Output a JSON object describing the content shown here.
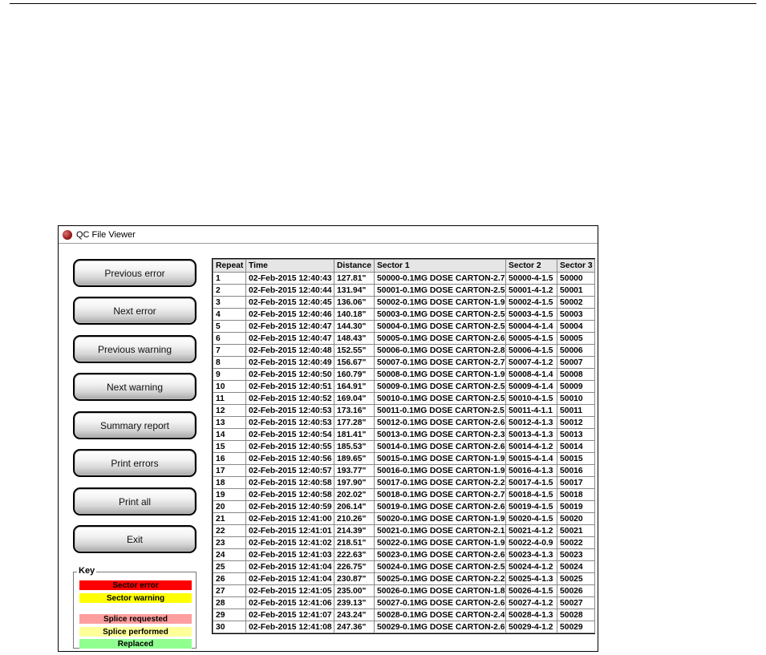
{
  "window": {
    "title": "QC File Viewer"
  },
  "buttons": [
    {
      "label": "Previous error"
    },
    {
      "label": "Next error"
    },
    {
      "label": "Previous warning"
    },
    {
      "label": "Next warning"
    },
    {
      "label": "Summary report"
    },
    {
      "label": "Print errors"
    },
    {
      "label": "Print all"
    },
    {
      "label": "Exit"
    }
  ],
  "key": {
    "title": "Key",
    "items": [
      {
        "label": "Sector error",
        "color": "#ff0000"
      },
      {
        "label": "Sector warning",
        "color": "#ffff00"
      },
      {
        "label": "Splice requested",
        "color": "#ff9e9e"
      },
      {
        "label": "Splice performed",
        "color": "#ffff99"
      },
      {
        "label": "Replaced",
        "color": "#90ff90"
      }
    ]
  },
  "table": {
    "columns": [
      "Repeat",
      "Time",
      "Distance",
      "Sector 1",
      "Sector 2",
      "Sector 3"
    ],
    "rows": [
      [
        "1",
        "02-Feb-2015 12:40:43",
        "127.81\"",
        "50000-0.1MG DOSE CARTON-2.7",
        "50000-4-1.5",
        "50000"
      ],
      [
        "2",
        "02-Feb-2015 12:40:44",
        "131.94\"",
        "50001-0.1MG DOSE CARTON-2.5",
        "50001-4-1.2",
        "50001"
      ],
      [
        "3",
        "02-Feb-2015 12:40:45",
        "136.06\"",
        "50002-0.1MG DOSE CARTON-1.9",
        "50002-4-1.5",
        "50002"
      ],
      [
        "4",
        "02-Feb-2015 12:40:46",
        "140.18\"",
        "50003-0.1MG DOSE CARTON-2.5",
        "50003-4-1.5",
        "50003"
      ],
      [
        "5",
        "02-Feb-2015 12:40:47",
        "144.30\"",
        "50004-0.1MG DOSE CARTON-2.5",
        "50004-4-1.4",
        "50004"
      ],
      [
        "6",
        "02-Feb-2015 12:40:47",
        "148.43\"",
        "50005-0.1MG DOSE CARTON-2.6",
        "50005-4-1.5",
        "50005"
      ],
      [
        "7",
        "02-Feb-2015 12:40:48",
        "152.55\"",
        "50006-0.1MG DOSE CARTON-2.8",
        "50006-4-1.5",
        "50006"
      ],
      [
        "8",
        "02-Feb-2015 12:40:49",
        "156.67\"",
        "50007-0.1MG DOSE CARTON-2.7",
        "50007-4-1.2",
        "50007"
      ],
      [
        "9",
        "02-Feb-2015 12:40:50",
        "160.79\"",
        "50008-0.1MG DOSE CARTON-1.9",
        "50008-4-1.4",
        "50008"
      ],
      [
        "10",
        "02-Feb-2015 12:40:51",
        "164.91\"",
        "50009-0.1MG DOSE CARTON-2.5",
        "50009-4-1.4",
        "50009"
      ],
      [
        "11",
        "02-Feb-2015 12:40:52",
        "169.04\"",
        "50010-0.1MG DOSE CARTON-2.5",
        "50010-4-1.5",
        "50010"
      ],
      [
        "12",
        "02-Feb-2015 12:40:53",
        "173.16\"",
        "50011-0.1MG DOSE CARTON-2.5",
        "50011-4-1.1",
        "50011"
      ],
      [
        "13",
        "02-Feb-2015 12:40:53",
        "177.28\"",
        "50012-0.1MG DOSE CARTON-2.6",
        "50012-4-1.3",
        "50012"
      ],
      [
        "14",
        "02-Feb-2015 12:40:54",
        "181.41\"",
        "50013-0.1MG DOSE CARTON-2.3",
        "50013-4-1.3",
        "50013"
      ],
      [
        "15",
        "02-Feb-2015 12:40:55",
        "185.53\"",
        "50014-0.1MG DOSE CARTON-2.6",
        "50014-4-1.2",
        "50014"
      ],
      [
        "16",
        "02-Feb-2015 12:40:56",
        "189.65\"",
        "50015-0.1MG DOSE CARTON-1.9",
        "50015-4-1.4",
        "50015"
      ],
      [
        "17",
        "02-Feb-2015 12:40:57",
        "193.77\"",
        "50016-0.1MG DOSE CARTON-1.9",
        "50016-4-1.3",
        "50016"
      ],
      [
        "18",
        "02-Feb-2015 12:40:58",
        "197.90\"",
        "50017-0.1MG DOSE CARTON-2.2",
        "50017-4-1.5",
        "50017"
      ],
      [
        "19",
        "02-Feb-2015 12:40:58",
        "202.02\"",
        "50018-0.1MG DOSE CARTON-2.7",
        "50018-4-1.5",
        "50018"
      ],
      [
        "20",
        "02-Feb-2015 12:40:59",
        "206.14\"",
        "50019-0.1MG DOSE CARTON-2.6",
        "50019-4-1.5",
        "50019"
      ],
      [
        "21",
        "02-Feb-2015 12:41:00",
        "210.26\"",
        "50020-0.1MG DOSE CARTON-1.9",
        "50020-4-1.5",
        "50020"
      ],
      [
        "22",
        "02-Feb-2015 12:41:01",
        "214.39\"",
        "50021-0.1MG DOSE CARTON-2.1",
        "50021-4-1.2",
        "50021"
      ],
      [
        "23",
        "02-Feb-2015 12:41:02",
        "218.51\"",
        "50022-0.1MG DOSE CARTON-1.9",
        "50022-4-0.9",
        "50022"
      ],
      [
        "24",
        "02-Feb-2015 12:41:03",
        "222.63\"",
        "50023-0.1MG DOSE CARTON-2.6",
        "50023-4-1.3",
        "50023"
      ],
      [
        "25",
        "02-Feb-2015 12:41:04",
        "226.75\"",
        "50024-0.1MG DOSE CARTON-2.5",
        "50024-4-1.2",
        "50024"
      ],
      [
        "26",
        "02-Feb-2015 12:41:04",
        "230.87\"",
        "50025-0.1MG DOSE CARTON-2.2",
        "50025-4-1.3",
        "50025"
      ],
      [
        "27",
        "02-Feb-2015 12:41:05",
        "235.00\"",
        "50026-0.1MG DOSE CARTON-1.8",
        "50026-4-1.5",
        "50026"
      ],
      [
        "28",
        "02-Feb-2015 12:41:06",
        "239.13\"",
        "50027-0.1MG DOSE CARTON-2.6",
        "50027-4-1.2",
        "50027"
      ],
      [
        "29",
        "02-Feb-2015 12:41:07",
        "243.24\"",
        "50028-0.1MG DOSE CARTON-2.4",
        "50028-4-1.3",
        "50028"
      ],
      [
        "30",
        "02-Feb-2015 12:41:08",
        "247.36\"",
        "50029-0.1MG DOSE CARTON-2.6",
        "50029-4-1.2",
        "50029"
      ]
    ]
  }
}
